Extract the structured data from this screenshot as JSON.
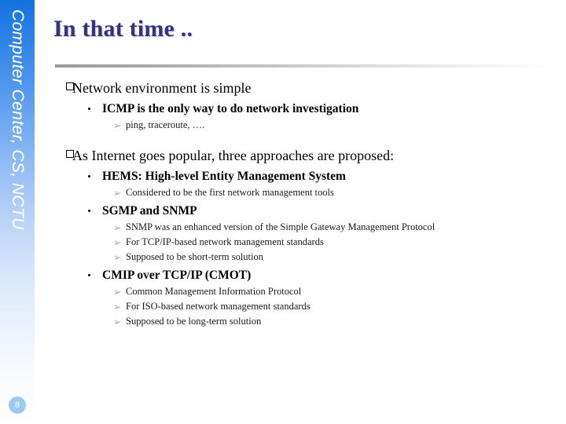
{
  "slide": {
    "title": "In that time ..",
    "page_number": "8",
    "sidebar_label": "Computer Center, CS, NCTU",
    "colors": {
      "title": "#33337F",
      "sidebar_top": "#1272E0",
      "sidebar_bottom": "#FFFFFF",
      "badge": "#9CCAF2",
      "rule": "#9A9A9A"
    },
    "bullets": {
      "level1_marker": "square-outline",
      "level2_marker": "round-dot",
      "level3_marker": "➢"
    },
    "sections": [
      {
        "heading": "Network environment is simple",
        "items": [
          {
            "text": "ICMP is the only way to do network investigation",
            "subitems": [
              "ping, traceroute, …."
            ]
          }
        ]
      },
      {
        "heading": "As Internet goes popular, three approaches are proposed:",
        "items": [
          {
            "text": "HEMS: High-level Entity Management System",
            "subitems": [
              "Considered to be the first network management tools"
            ]
          },
          {
            "text": "SGMP and SNMP",
            "subitems": [
              "SNMP was an enhanced version of the Simple Gateway Management Protocol",
              "For TCP/IP-based network management standards",
              "Supposed to be short-term solution"
            ]
          },
          {
            "text": "CMIP over TCP/IP (CMOT)",
            "subitems": [
              "Common Management Information Protocol",
              "For ISO-based network management standards",
              "Supposed to be long-term solution"
            ]
          }
        ]
      }
    ]
  }
}
